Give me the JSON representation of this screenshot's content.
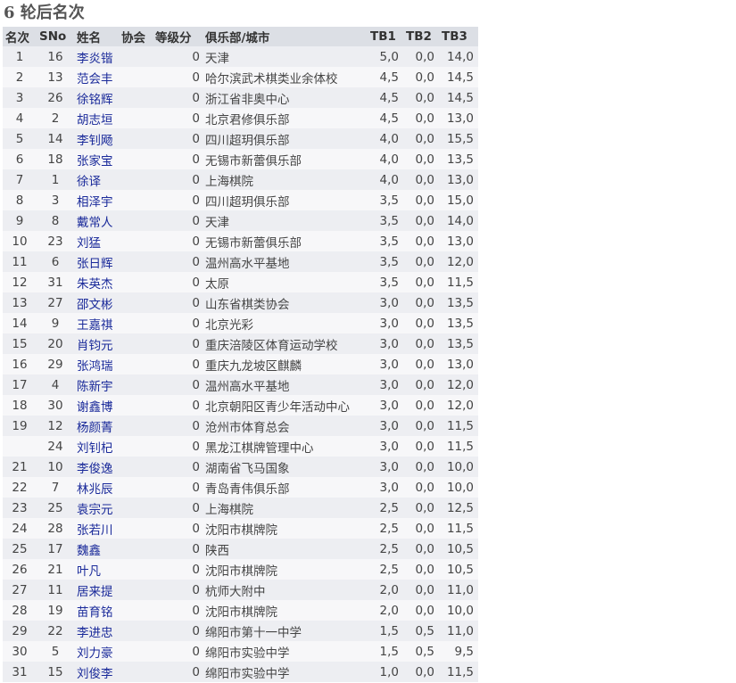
{
  "title": "6 轮后名次",
  "headers": {
    "rank": "名次",
    "sno": "SNo",
    "name": "姓名",
    "assoc": "协会",
    "rating": "等级分",
    "club": "俱乐部/城市",
    "tb1": "TB1",
    "tb2": "TB2",
    "tb3": "TB3"
  },
  "rows": [
    {
      "rank": "1",
      "sno": "16",
      "name": "李炎锴",
      "rating": "0",
      "club": "天津",
      "tb1": "5,0",
      "tb2": "0,0",
      "tb3": "14,0"
    },
    {
      "rank": "2",
      "sno": "13",
      "name": "范会丰",
      "rating": "0",
      "club": "哈尔滨武术棋类业余体校",
      "tb1": "4,5",
      "tb2": "0,0",
      "tb3": "14,5"
    },
    {
      "rank": "3",
      "sno": "26",
      "name": "徐铭辉",
      "rating": "0",
      "club": "浙江省非奥中心",
      "tb1": "4,5",
      "tb2": "0,0",
      "tb3": "14,5"
    },
    {
      "rank": "4",
      "sno": "2",
      "name": "胡志垣",
      "rating": "0",
      "club": "北京君修俱乐部",
      "tb1": "4,5",
      "tb2": "0,0",
      "tb3": "13,0"
    },
    {
      "rank": "5",
      "sno": "14",
      "name": "李钊飏",
      "rating": "0",
      "club": "四川超玥俱乐部",
      "tb1": "4,0",
      "tb2": "0,0",
      "tb3": "15,5"
    },
    {
      "rank": "6",
      "sno": "18",
      "name": "张家宝",
      "rating": "0",
      "club": "无锡市新蕾俱乐部",
      "tb1": "4,0",
      "tb2": "0,0",
      "tb3": "13,5"
    },
    {
      "rank": "7",
      "sno": "1",
      "name": "徐译",
      "rating": "0",
      "club": "上海棋院",
      "tb1": "4,0",
      "tb2": "0,0",
      "tb3": "13,0"
    },
    {
      "rank": "8",
      "sno": "3",
      "name": "相泽宇",
      "rating": "0",
      "club": "四川超玥俱乐部",
      "tb1": "3,5",
      "tb2": "0,0",
      "tb3": "15,0"
    },
    {
      "rank": "9",
      "sno": "8",
      "name": "戴常人",
      "rating": "0",
      "club": "天津",
      "tb1": "3,5",
      "tb2": "0,0",
      "tb3": "14,0"
    },
    {
      "rank": "10",
      "sno": "23",
      "name": "刘猛",
      "rating": "0",
      "club": "无锡市新蕾俱乐部",
      "tb1": "3,5",
      "tb2": "0,0",
      "tb3": "13,0"
    },
    {
      "rank": "11",
      "sno": "6",
      "name": "张日辉",
      "rating": "0",
      "club": "温州高水平基地",
      "tb1": "3,5",
      "tb2": "0,0",
      "tb3": "12,0"
    },
    {
      "rank": "12",
      "sno": "31",
      "name": "朱英杰",
      "rating": "0",
      "club": "太原",
      "tb1": "3,5",
      "tb2": "0,0",
      "tb3": "11,5"
    },
    {
      "rank": "13",
      "sno": "27",
      "name": "邵文彬",
      "rating": "0",
      "club": "山东省棋类协会",
      "tb1": "3,0",
      "tb2": "0,0",
      "tb3": "13,5"
    },
    {
      "rank": "14",
      "sno": "9",
      "name": "王嘉祺",
      "rating": "0",
      "club": "北京光彩",
      "tb1": "3,0",
      "tb2": "0,0",
      "tb3": "13,5"
    },
    {
      "rank": "15",
      "sno": "20",
      "name": "肖钧元",
      "rating": "0",
      "club": "重庆涪陵区体育运动学校",
      "tb1": "3,0",
      "tb2": "0,0",
      "tb3": "13,5"
    },
    {
      "rank": "16",
      "sno": "29",
      "name": "张鸿瑞",
      "rating": "0",
      "club": "重庆九龙坡区麒麟",
      "tb1": "3,0",
      "tb2": "0,0",
      "tb3": "13,0"
    },
    {
      "rank": "17",
      "sno": "4",
      "name": "陈新宇",
      "rating": "0",
      "club": "温州高水平基地",
      "tb1": "3,0",
      "tb2": "0,0",
      "tb3": "12,0"
    },
    {
      "rank": "18",
      "sno": "30",
      "name": "谢鑫博",
      "rating": "0",
      "club": "北京朝阳区青少年活动中心",
      "tb1": "3,0",
      "tb2": "0,0",
      "tb3": "12,0"
    },
    {
      "rank": "19",
      "sno": "12",
      "name": "杨颜菁",
      "rating": "0",
      "club": "沧州市体育总会",
      "tb1": "3,0",
      "tb2": "0,0",
      "tb3": "11,5"
    },
    {
      "rank": "",
      "sno": "24",
      "name": "刘钊杞",
      "rating": "0",
      "club": "黑龙江棋牌管理中心",
      "tb1": "3,0",
      "tb2": "0,0",
      "tb3": "11,5"
    },
    {
      "rank": "21",
      "sno": "10",
      "name": "李俊逸",
      "rating": "0",
      "club": "湖南省飞马国象",
      "tb1": "3,0",
      "tb2": "0,0",
      "tb3": "10,0"
    },
    {
      "rank": "22",
      "sno": "7",
      "name": "林兆辰",
      "rating": "0",
      "club": "青岛青伟俱乐部",
      "tb1": "3,0",
      "tb2": "0,0",
      "tb3": "10,0"
    },
    {
      "rank": "23",
      "sno": "25",
      "name": "袁宗元",
      "rating": "0",
      "club": "上海棋院",
      "tb1": "2,5",
      "tb2": "0,0",
      "tb3": "12,5"
    },
    {
      "rank": "24",
      "sno": "28",
      "name": "张若川",
      "rating": "0",
      "club": "沈阳市棋牌院",
      "tb1": "2,5",
      "tb2": "0,0",
      "tb3": "11,5"
    },
    {
      "rank": "25",
      "sno": "17",
      "name": "魏鑫",
      "rating": "0",
      "club": "陕西",
      "tb1": "2,5",
      "tb2": "0,0",
      "tb3": "10,5"
    },
    {
      "rank": "26",
      "sno": "21",
      "name": "叶凡",
      "rating": "0",
      "club": "沈阳市棋牌院",
      "tb1": "2,5",
      "tb2": "0,0",
      "tb3": "10,5"
    },
    {
      "rank": "27",
      "sno": "11",
      "name": "居来提",
      "rating": "0",
      "club": "杭师大附中",
      "tb1": "2,0",
      "tb2": "0,0",
      "tb3": "11,0"
    },
    {
      "rank": "28",
      "sno": "19",
      "name": "苗育铭",
      "rating": "0",
      "club": "沈阳市棋牌院",
      "tb1": "2,0",
      "tb2": "0,0",
      "tb3": "10,0"
    },
    {
      "rank": "29",
      "sno": "22",
      "name": "李进忠",
      "rating": "0",
      "club": "绵阳市第十一中学",
      "tb1": "1,5",
      "tb2": "0,5",
      "tb3": "11,0"
    },
    {
      "rank": "30",
      "sno": "5",
      "name": "刘力豪",
      "rating": "0",
      "club": "绵阳市实验中学",
      "tb1": "1,5",
      "tb2": "0,5",
      "tb3": "9,5"
    },
    {
      "rank": "31",
      "sno": "15",
      "name": "刘俊李",
      "rating": "0",
      "club": "绵阳市实验中学",
      "tb1": "1,0",
      "tb2": "0,0",
      "tb3": "11,5"
    }
  ]
}
